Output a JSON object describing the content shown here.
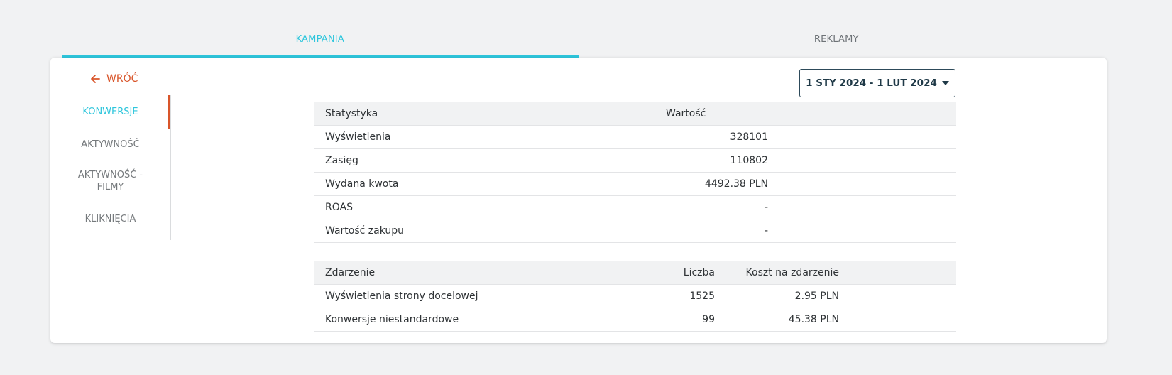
{
  "tabs": [
    {
      "label": "KAMPANIA",
      "active": true
    },
    {
      "label": "REKLAMY",
      "active": false
    }
  ],
  "back": {
    "label": "WRÓĆ",
    "icon": "arrow-left-icon"
  },
  "sidebar": {
    "items": [
      {
        "label": "KONWERSJE",
        "active": true
      },
      {
        "label": "AKTYWNOŚĆ"
      },
      {
        "label": "AKTYWNOŚĆ -",
        "label2": "FILMY"
      },
      {
        "label": "KLIKNIĘCIA"
      }
    ]
  },
  "date_range": {
    "label": "1 STY 2024 - 1 LUT 2024",
    "icon": "caret-down-icon"
  },
  "stats_table": {
    "headers": [
      "Statystyka",
      "Wartość"
    ],
    "rows": [
      {
        "name": "Wyświetlenia",
        "value": "328101"
      },
      {
        "name": "Zasięg",
        "value": "110802"
      },
      {
        "name": "Wydana kwota",
        "value": "4492.38 PLN"
      },
      {
        "name": "ROAS",
        "value": "-"
      },
      {
        "name": "Wartość zakupu",
        "value": "-"
      }
    ]
  },
  "events_table": {
    "headers": [
      "Zdarzenie",
      "Liczba",
      "Koszt na zdarzenie"
    ],
    "rows": [
      {
        "name": "Wyświetlenia strony docelowej",
        "count": "1525",
        "cost": "2.95 PLN"
      },
      {
        "name": "Konwersje niestandardowe",
        "count": "99",
        "cost": "45.38 PLN"
      }
    ]
  },
  "colors": {
    "accent": "#2ec6dc",
    "back": "#d9552a",
    "indicator": "#d9552a"
  }
}
